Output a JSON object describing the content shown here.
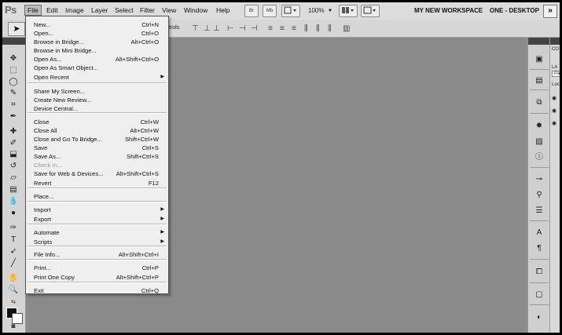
{
  "app": {
    "logo": "Ps"
  },
  "menubar": {
    "items": [
      "File",
      "Edit",
      "Image",
      "Layer",
      "Select",
      "Filter",
      "View",
      "Window",
      "Help"
    ],
    "bridge_label": "Br",
    "minibridge_label": "Mb",
    "zoom": "100%",
    "workspace": "MY NEW WORKSPACE",
    "desktop": "ONE - DESKTOP",
    "expand_icon": "»"
  },
  "optbar": {
    "controls_text": "trols",
    "tool_icon": "move-tool-icon"
  },
  "file_menu": {
    "items": [
      {
        "label": "New...",
        "shortcut": "Ctrl+N"
      },
      {
        "label": "Open...",
        "shortcut": "Ctrl+O"
      },
      {
        "label": "Browse in Bridge...",
        "shortcut": "Alt+Ctrl+O"
      },
      {
        "label": "Browse in Mini Bridge...",
        "shortcut": ""
      },
      {
        "label": "Open As...",
        "shortcut": "Alt+Shift+Ctrl+O"
      },
      {
        "label": "Open As Smart Object...",
        "shortcut": ""
      },
      {
        "label": "Open Recent",
        "shortcut": "",
        "submenu": true
      },
      {
        "label": "Share My Screen...",
        "shortcut": ""
      },
      {
        "label": "Create New Review...",
        "shortcut": ""
      },
      {
        "label": "Device Central...",
        "shortcut": ""
      },
      {
        "label": "Close",
        "shortcut": "Ctrl+W"
      },
      {
        "label": "Close All",
        "shortcut": "Alt+Ctrl+W"
      },
      {
        "label": "Close and Go To Bridge...",
        "shortcut": "Shift+Ctrl+W"
      },
      {
        "label": "Save",
        "shortcut": "Ctrl+S"
      },
      {
        "label": "Save As...",
        "shortcut": "Shift+Ctrl+S"
      },
      {
        "label": "Check In...",
        "shortcut": "",
        "disabled": true
      },
      {
        "label": "Save for Web & Devices...",
        "shortcut": "Alt+Shift+Ctrl+S"
      },
      {
        "label": "Revert",
        "shortcut": "F12"
      },
      {
        "label": "Place...",
        "shortcut": ""
      },
      {
        "label": "Import",
        "shortcut": "",
        "submenu": true
      },
      {
        "label": "Export",
        "shortcut": "",
        "submenu": true
      },
      {
        "label": "Automate",
        "shortcut": "",
        "submenu": true
      },
      {
        "label": "Scripts",
        "shortcut": "",
        "submenu": true
      },
      {
        "label": "File Info...",
        "shortcut": "Alt+Shift+Ctrl+I"
      },
      {
        "label": "Print...",
        "shortcut": "Ctrl+P"
      },
      {
        "label": "Print One Copy",
        "shortcut": "Alt+Shift+Ctrl+P"
      },
      {
        "label": "Exit",
        "shortcut": "Ctrl+Q"
      }
    ]
  },
  "right_panel": {
    "tab1": "CO",
    "tab2": "LA",
    "field": "Pa",
    "lock": "Loc"
  },
  "colors": {
    "canvas": "#8a8a8a",
    "menu_bg": "#efefef",
    "chrome": "#d6d6d6"
  }
}
